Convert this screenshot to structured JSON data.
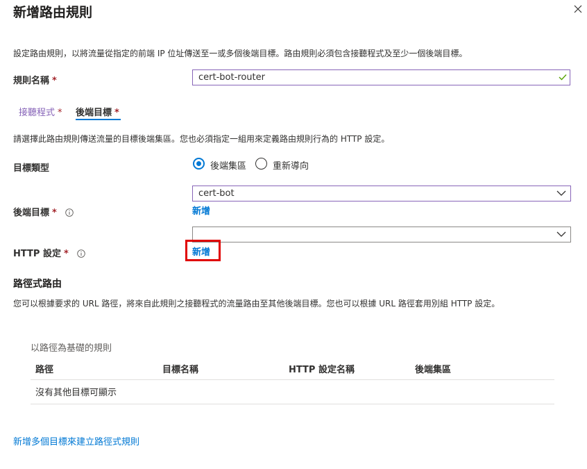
{
  "header": {
    "title": "新增路由規則",
    "close_icon": "close-icon"
  },
  "intro_text": "設定路由規則，以將流量從指定的前端 IP 位址傳送至一或多個後端目標。路由規則必須包含接聽程式及至少一個後端目標。",
  "rule_name": {
    "label": "規則名稱",
    "required": "*",
    "value": "cert-bot-router",
    "valid_icon": "checkmark-icon"
  },
  "tabs": [
    {
      "label": "接聽程式",
      "required": "*",
      "selected": false
    },
    {
      "label": "後端目標",
      "required": "*",
      "selected": true
    }
  ],
  "backend_tab": {
    "description": "請選擇此路由規則傳送流量的目標後端集區。您也必須指定一組用來定義路由規則行為的 HTTP 設定。",
    "target_type": {
      "label": "目標類型",
      "options": [
        {
          "label": "後端集區",
          "selected": true
        },
        {
          "label": "重新導向",
          "selected": false
        }
      ]
    },
    "backend_target": {
      "label": "後端目標",
      "required": "*",
      "value": "cert-bot",
      "add_link": "新增",
      "info_icon": "info-icon"
    },
    "http_settings": {
      "label": "HTTP 設定",
      "required": "*",
      "value": "",
      "add_link": "新增",
      "info_icon": "info-icon"
    }
  },
  "path_routing": {
    "heading": "路徑式路由",
    "description": "您可以根據要求的 URL 路徑，將來自此規則之接聽程式的流量路由至其他後端目標。您也可以根據 URL 路徑套用別組 HTTP 設定。",
    "table": {
      "title": "以路徑為基礎的規則",
      "columns": [
        "路徑",
        "目標名稱",
        "HTTP 設定名稱",
        "後端集區"
      ],
      "empty_text": "沒有其他目標可顯示"
    },
    "add_multiple_link": "新增多個目標來建立路徑式規則"
  },
  "colors": {
    "accent": "#0078d4",
    "focus_border": "#8764b8",
    "required": "#a4262c",
    "highlight": "#e00000"
  }
}
